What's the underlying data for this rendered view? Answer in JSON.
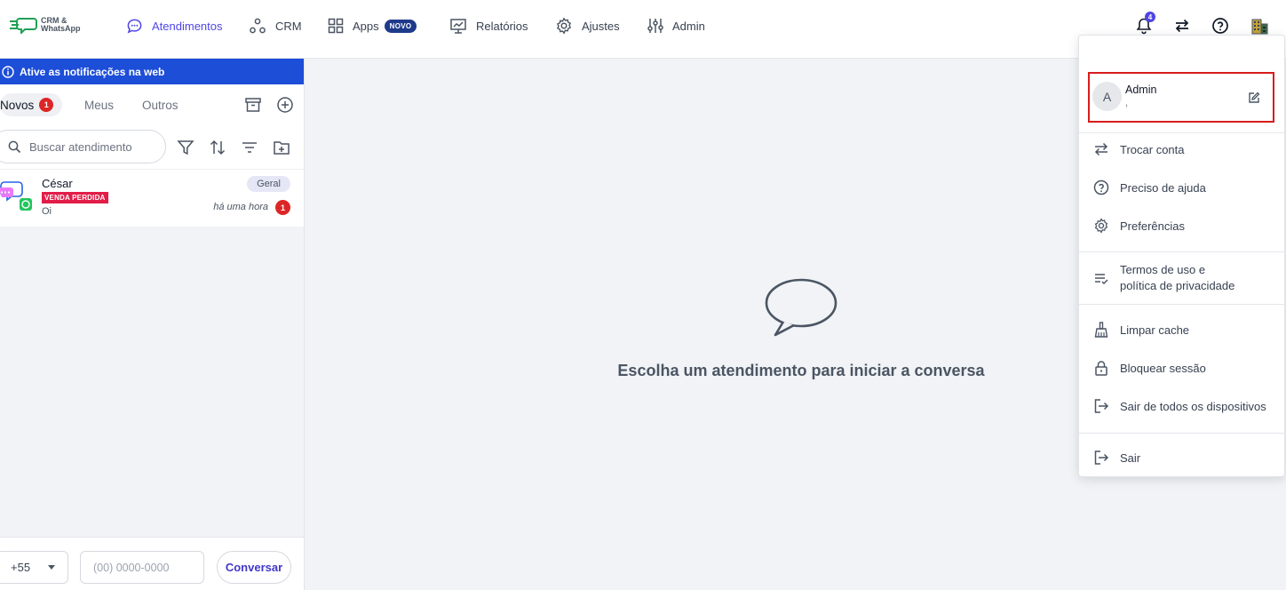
{
  "header": {
    "logo_text": "CRM & WhatsApp",
    "nav": [
      {
        "label": "Atendimentos",
        "active": true
      },
      {
        "label": "CRM"
      },
      {
        "label": "Apps",
        "badge": "NOVO"
      },
      {
        "label": "Relatórios"
      },
      {
        "label": "Ajustes"
      },
      {
        "label": "Admin"
      }
    ],
    "notification_count": "4"
  },
  "sidebar": {
    "banner": "Ative as notificações na web",
    "tabs": [
      {
        "label": "Novos",
        "count": "1",
        "active": true
      },
      {
        "label": "Meus"
      },
      {
        "label": "Outros"
      }
    ],
    "search_placeholder": "Buscar atendimento",
    "chats": [
      {
        "name": "César",
        "tag": "VENDA PERDIDA",
        "last_message": "Oi",
        "queue": "Geral",
        "time": "há uma hora",
        "unread": "1"
      }
    ],
    "footer": {
      "country_code": "+55",
      "phone_placeholder": "(00) 0000-0000",
      "start_button": "Conversar"
    }
  },
  "main": {
    "empty_message": "Escolha um atendimento para iniciar a conversa"
  },
  "user_menu": {
    "profile": {
      "initial": "A",
      "name": "Admin",
      "subtitle": ","
    },
    "items": [
      {
        "label": "Trocar conta",
        "icon": "swap-icon"
      },
      {
        "label": "Preciso de ajuda",
        "icon": "help-icon"
      },
      {
        "label": "Preferências",
        "icon": "gear-icon"
      },
      {
        "label_line1": "Termos de uso e",
        "label_line2": "política de privacidade",
        "icon": "list-check-icon"
      },
      {
        "label": "Limpar cache",
        "icon": "broom-icon"
      },
      {
        "label": "Bloquear sessão",
        "icon": "lock-icon"
      },
      {
        "label": "Sair de todos os dispositivos",
        "icon": "logout-icon"
      },
      {
        "label": "Sair",
        "icon": "logout-icon"
      }
    ]
  },
  "colors": {
    "accent": "#4f46e5",
    "banner": "#1d4ed8",
    "badge_red": "#dc2626",
    "tag_red": "#e11d48",
    "highlight_border": "#d91c1c"
  }
}
